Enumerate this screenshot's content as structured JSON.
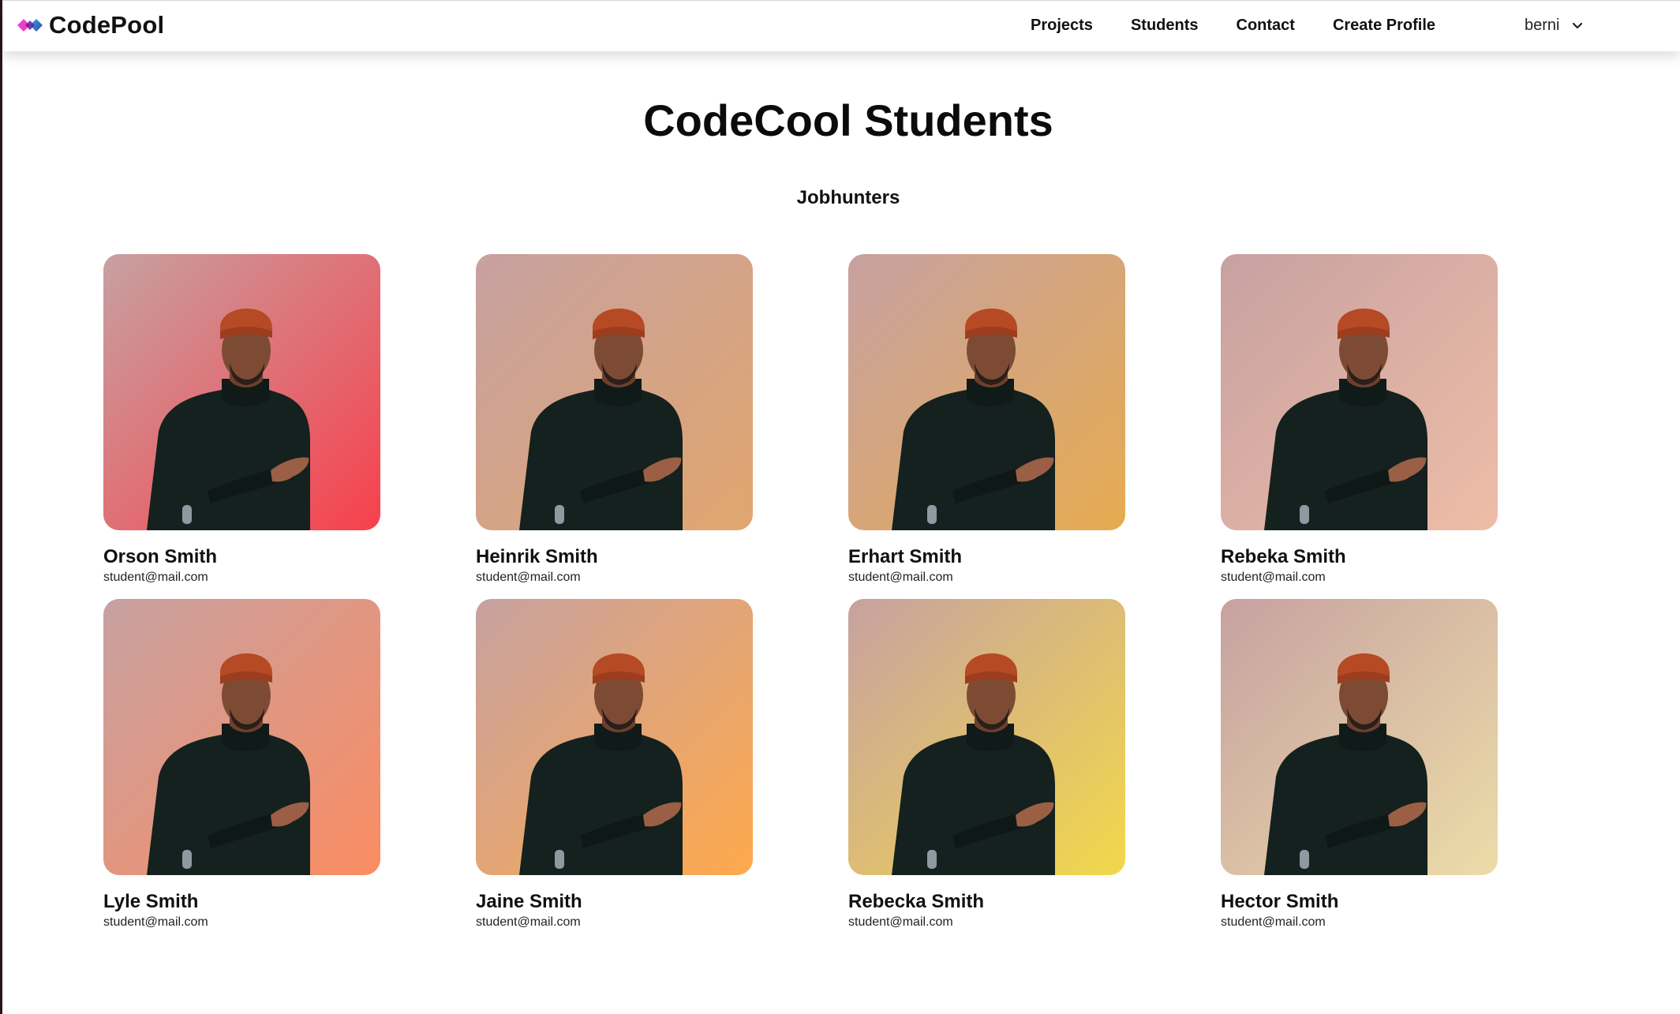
{
  "app": {
    "brand": "CodePool",
    "logo_icon": "codepool-logo-icon"
  },
  "nav": {
    "items": [
      {
        "label": "Projects"
      },
      {
        "label": "Students"
      },
      {
        "label": "Contact"
      },
      {
        "label": "Create Profile"
      }
    ],
    "user": {
      "name": "berni",
      "menu_icon": "chevron-down-icon"
    }
  },
  "page": {
    "title": "CodeCool Students",
    "section": "Jobhunters"
  },
  "students": [
    {
      "name": "Orson Smith",
      "email": "student@mail.com",
      "photo_colors": [
        "#c7a1a1",
        "#f7404c"
      ]
    },
    {
      "name": "Heinrik Smith",
      "email": "student@mail.com",
      "photo_colors": [
        "#c7a1a1",
        "#e1a66e"
      ]
    },
    {
      "name": "Erhart Smith",
      "email": "student@mail.com",
      "photo_colors": [
        "#c7a1a1",
        "#e6ab50"
      ]
    },
    {
      "name": "Rebeka Smith",
      "email": "student@mail.com",
      "photo_colors": [
        "#c7a1a1",
        "#eebda7"
      ]
    },
    {
      "name": "Lyle Smith",
      "email": "student@mail.com",
      "photo_colors": [
        "#c7a1a1",
        "#fb8c62"
      ]
    },
    {
      "name": "Jaine Smith",
      "email": "student@mail.com",
      "photo_colors": [
        "#c7a1a1",
        "#fea94b"
      ]
    },
    {
      "name": "Rebecka Smith",
      "email": "student@mail.com",
      "photo_colors": [
        "#c7a1a1",
        "#f2d84a"
      ]
    },
    {
      "name": "Hector Smith",
      "email": "student@mail.com",
      "photo_colors": [
        "#c7a1a1",
        "#ecdca8"
      ]
    }
  ]
}
